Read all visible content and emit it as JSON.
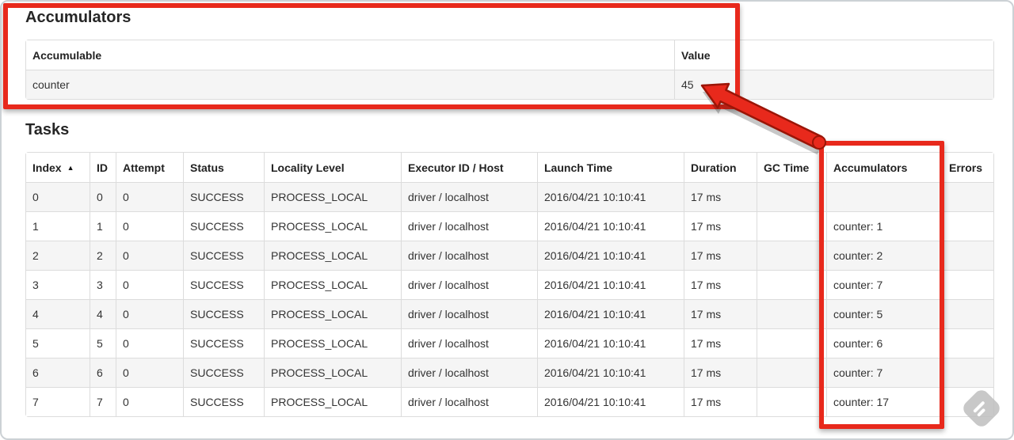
{
  "accumulators": {
    "title": "Accumulators",
    "columns": [
      "Accumulable",
      "Value"
    ],
    "rows": [
      {
        "accumulable": "counter",
        "value": "45"
      }
    ]
  },
  "tasks": {
    "title": "Tasks",
    "sort_indicator": "▲",
    "columns": [
      "Index",
      "ID",
      "Attempt",
      "Status",
      "Locality Level",
      "Executor ID / Host",
      "Launch Time",
      "Duration",
      "GC Time",
      "Accumulators",
      "Errors"
    ],
    "rows": [
      {
        "index": "0",
        "id": "0",
        "attempt": "0",
        "status": "SUCCESS",
        "locality_level": "PROCESS_LOCAL",
        "executor_id_host": "driver / localhost",
        "launch_time": "2016/04/21 10:10:41",
        "duration": "17 ms",
        "gc_time": "",
        "accumulators": "",
        "errors": ""
      },
      {
        "index": "1",
        "id": "1",
        "attempt": "0",
        "status": "SUCCESS",
        "locality_level": "PROCESS_LOCAL",
        "executor_id_host": "driver / localhost",
        "launch_time": "2016/04/21 10:10:41",
        "duration": "17 ms",
        "gc_time": "",
        "accumulators": "counter: 1",
        "errors": ""
      },
      {
        "index": "2",
        "id": "2",
        "attempt": "0",
        "status": "SUCCESS",
        "locality_level": "PROCESS_LOCAL",
        "executor_id_host": "driver / localhost",
        "launch_time": "2016/04/21 10:10:41",
        "duration": "17 ms",
        "gc_time": "",
        "accumulators": "counter: 2",
        "errors": ""
      },
      {
        "index": "3",
        "id": "3",
        "attempt": "0",
        "status": "SUCCESS",
        "locality_level": "PROCESS_LOCAL",
        "executor_id_host": "driver / localhost",
        "launch_time": "2016/04/21 10:10:41",
        "duration": "17 ms",
        "gc_time": "",
        "accumulators": "counter: 7",
        "errors": ""
      },
      {
        "index": "4",
        "id": "4",
        "attempt": "0",
        "status": "SUCCESS",
        "locality_level": "PROCESS_LOCAL",
        "executor_id_host": "driver / localhost",
        "launch_time": "2016/04/21 10:10:41",
        "duration": "17 ms",
        "gc_time": "",
        "accumulators": "counter: 5",
        "errors": ""
      },
      {
        "index": "5",
        "id": "5",
        "attempt": "0",
        "status": "SUCCESS",
        "locality_level": "PROCESS_LOCAL",
        "executor_id_host": "driver / localhost",
        "launch_time": "2016/04/21 10:10:41",
        "duration": "17 ms",
        "gc_time": "",
        "accumulators": "counter: 6",
        "errors": ""
      },
      {
        "index": "6",
        "id": "6",
        "attempt": "0",
        "status": "SUCCESS",
        "locality_level": "PROCESS_LOCAL",
        "executor_id_host": "driver / localhost",
        "launch_time": "2016/04/21 10:10:41",
        "duration": "17 ms",
        "gc_time": "",
        "accumulators": "counter: 7",
        "errors": ""
      },
      {
        "index": "7",
        "id": "7",
        "attempt": "0",
        "status": "SUCCESS",
        "locality_level": "PROCESS_LOCAL",
        "executor_id_host": "driver / localhost",
        "launch_time": "2016/04/21 10:10:41",
        "duration": "17 ms",
        "gc_time": "",
        "accumulators": "counter: 17",
        "errors": ""
      }
    ]
  },
  "annotations": {
    "color": "#e8291c",
    "outline": "#9b1507"
  },
  "watermark": {
    "icon": "feedly-icon"
  }
}
